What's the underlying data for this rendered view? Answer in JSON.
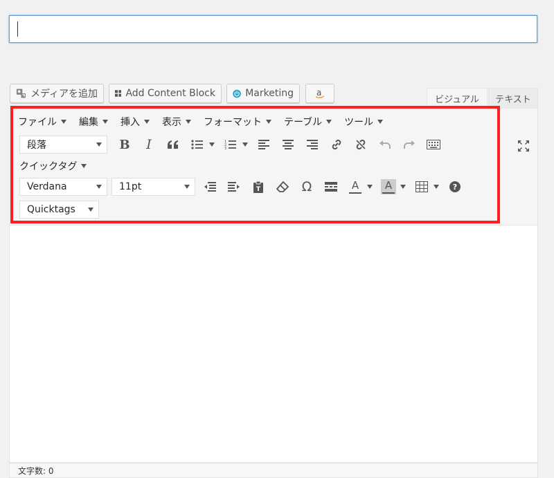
{
  "title_input": {
    "value": ""
  },
  "media_buttons": [
    {
      "label": "メディアを追加",
      "icon": "media-icon"
    },
    {
      "label": "Add Content Block",
      "icon": "grid-icon"
    },
    {
      "label": "Marketing",
      "icon": "power-icon"
    },
    {
      "label": "",
      "icon": "amazon-icon"
    }
  ],
  "tabs": {
    "visual": "ビジュアル",
    "text": "テキスト"
  },
  "menubar": [
    "ファイル",
    "編集",
    "挿入",
    "表示",
    "フォーマット",
    "テーブル",
    "ツール"
  ],
  "toolbar": {
    "block_format": "段落",
    "quicktag_label": "クイックタグ",
    "font_family": "Verdana",
    "font_size": "11pt",
    "quicktags_select": "Quicktags",
    "text_color_glyph": "A",
    "bg_color_glyph": "A",
    "omega_glyph": "Ω",
    "quote_glyph": "“",
    "bold_glyph": "B",
    "italic_glyph": "I"
  },
  "status": {
    "word_count": "文字数: 0"
  },
  "colors": {
    "highlight": "#ff1f1f",
    "focus": "#5b9dd9",
    "icon": "#555555"
  }
}
